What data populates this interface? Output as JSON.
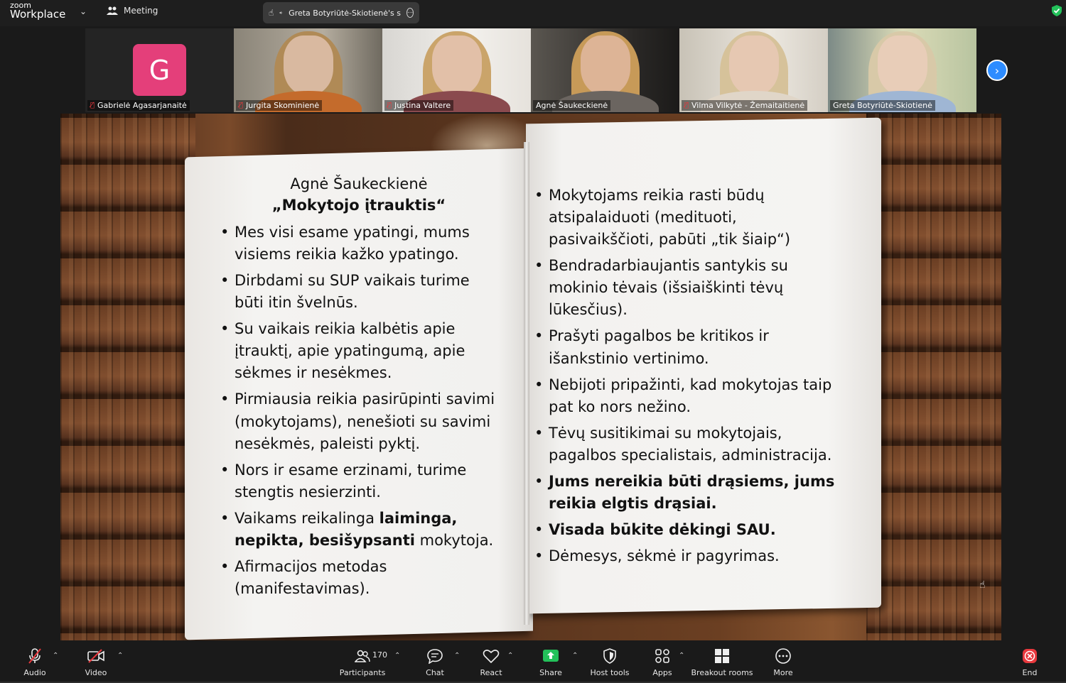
{
  "topbar": {
    "brand_top": "zoom",
    "brand_bottom": "Workplace",
    "meeting_label": "Meeting",
    "share_label": "Greta Botyriūtė-Skiotienė's s"
  },
  "participants_strip": [
    {
      "name": "Gabrielė Agasarjanaitė",
      "avatar_letter": "G",
      "muted": true,
      "video": false
    },
    {
      "name": "Jurgita Skominienė",
      "muted": true,
      "video": true
    },
    {
      "name": "Justina Valtere",
      "muted": true,
      "video": true
    },
    {
      "name": "Agnė Šaukeckienė",
      "muted": false,
      "video": true
    },
    {
      "name": "Vilma Vilkytė - Žemaitaitienė",
      "muted": true,
      "video": true
    },
    {
      "name": "Greta Botyriūtė-Skiotienė",
      "muted": false,
      "video": true,
      "active_speaker": true
    }
  ],
  "slide": {
    "author": "Agnė Šaukeckienė",
    "title": "„Mokytojo įtrauktis“",
    "left_items": [
      "Mes visi esame ypatingi, mums visiems reikia kažko ypatingo.",
      "Dirbdami su SUP vaikais turime būti itin švelnūs.",
      "Su vaikais reikia kalbėtis apie įtrauktį, apie ypatingumą, apie sėkmes ir nesėkmes.",
      "Pirmiausia reikia pasirūpinti savimi (mokytojams), nenešioti su savimi nesėkmės, paleisti pyktį.",
      "Nors ir esame erzinami, turime stengtis nesierzinti."
    ],
    "left_item6_pre": "Vaikams reikalinga ",
    "left_item6_bold": "laiminga, nepikta, besišypsanti",
    "left_item6_post": " mokytoja.",
    "left_item7": "Afirmacijos metodas (manifestavimas).",
    "right_items": [
      "Mokytojams reikia rasti būdų atsipalaiduoti (medituoti, pasivaikščioti, pabūti „tik šiaip“)",
      "Bendradarbiaujantis santykis su mokinio tėvais (išsiaiškinti tėvų lūkesčius).",
      "Prašyti pagalbos be kritikos ir išankstinio vertinimo.",
      "Nebijoti pripažinti, kad mokytojas taip pat ko nors nežino.",
      "Tėvų susitikimai su mokytojais, pagalbos specialistais, administracija."
    ],
    "right_bold_1": "Jums nereikia būti drąsiems, jums reikia elgtis drąsiai.",
    "right_bold_2": "Visada būkite dėkingi SAU.",
    "right_last": "Dėmesys, sėkmė ir pagyrimas."
  },
  "toolbar": {
    "audio": "Audio",
    "video": "Video",
    "participants": "Participants",
    "participants_count": "170",
    "chat": "Chat",
    "react": "React",
    "share": "Share",
    "host_tools": "Host tools",
    "apps": "Apps",
    "breakout": "Breakout rooms",
    "more": "More",
    "end": "End"
  },
  "colors": {
    "accent_blue": "#2d8cff",
    "active_green": "#2ed47a",
    "mute_red": "#e8383d",
    "share_green": "#23c15a",
    "avatar_pink": "#e43f7a"
  }
}
